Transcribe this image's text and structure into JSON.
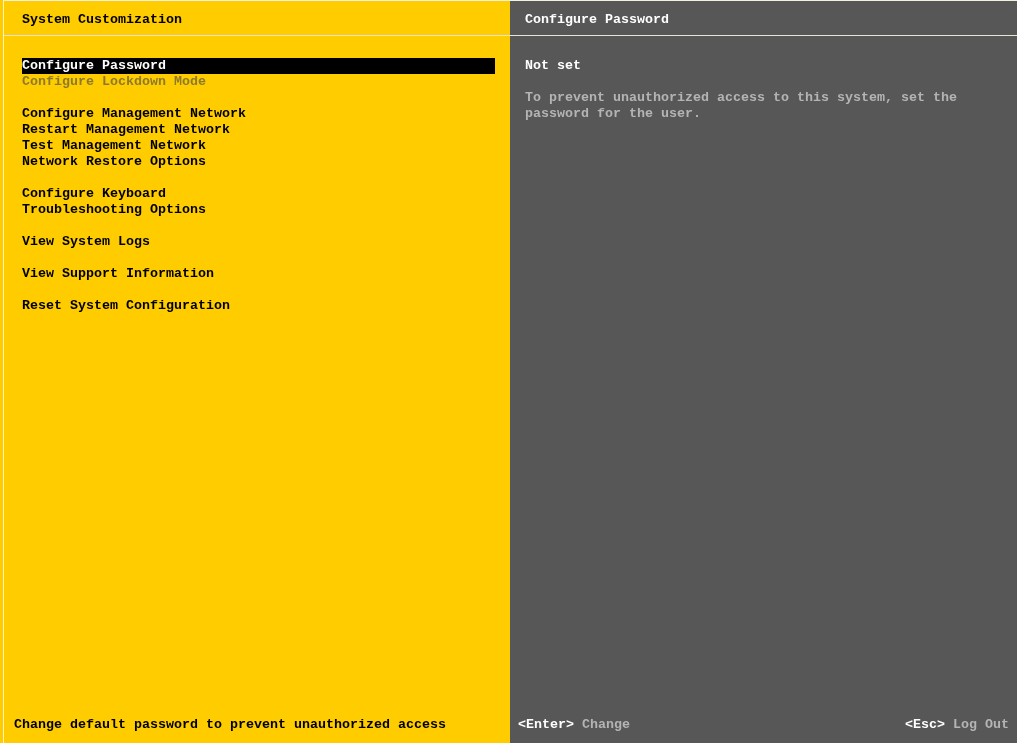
{
  "left_panel": {
    "title": "System Customization",
    "menu_groups": [
      {
        "items": [
          {
            "label": "Configure Password",
            "selected": true,
            "disabled": false
          },
          {
            "label": "Configure Lockdown Mode",
            "selected": false,
            "disabled": true
          }
        ]
      },
      {
        "items": [
          {
            "label": "Configure Management Network",
            "selected": false,
            "disabled": false
          },
          {
            "label": "Restart Management Network",
            "selected": false,
            "disabled": false
          },
          {
            "label": "Test Management Network",
            "selected": false,
            "disabled": false
          },
          {
            "label": "Network Restore Options",
            "selected": false,
            "disabled": false
          }
        ]
      },
      {
        "items": [
          {
            "label": "Configure Keyboard",
            "selected": false,
            "disabled": false
          },
          {
            "label": "Troubleshooting Options",
            "selected": false,
            "disabled": false
          }
        ]
      },
      {
        "items": [
          {
            "label": "View System Logs",
            "selected": false,
            "disabled": false
          }
        ]
      },
      {
        "items": [
          {
            "label": "View Support Information",
            "selected": false,
            "disabled": false
          }
        ]
      },
      {
        "items": [
          {
            "label": "Reset System Configuration",
            "selected": false,
            "disabled": false
          }
        ]
      }
    ],
    "hint": "Change default password to prevent unauthorized access"
  },
  "right_panel": {
    "title": "Configure Password",
    "status": "Not set",
    "description": "To prevent unauthorized access to this system, set the password for the user.",
    "key_actions": [
      {
        "key": "<Enter>",
        "action": "Change"
      },
      {
        "key": "<Esc>",
        "action": "Log Out"
      }
    ]
  }
}
